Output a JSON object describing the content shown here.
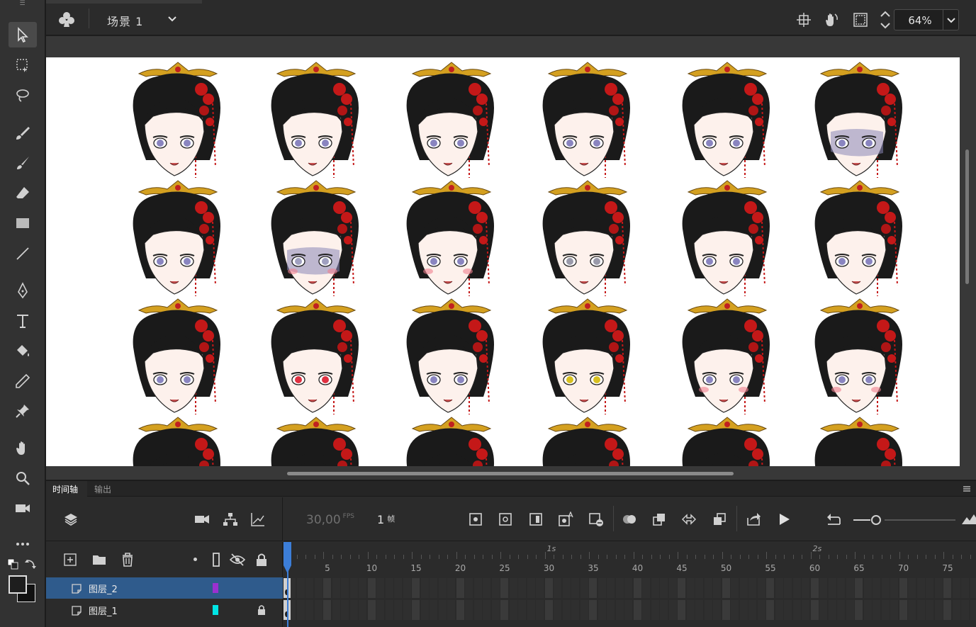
{
  "stage": {
    "scene_name": "场景 1",
    "zoom": "64%"
  },
  "timeline": {
    "tabs": [
      "时间轴",
      "输出"
    ],
    "fps": "30,00",
    "fps_unit": "FPS",
    "current_frame": "1",
    "frame_unit": "帧",
    "ruler_ticks": [
      "5",
      "10",
      "15",
      "20",
      "25",
      "30",
      "35",
      "40",
      "45",
      "50",
      "55",
      "60",
      "65",
      "70",
      "75"
    ],
    "second_labels": [
      "1s",
      "2s"
    ],
    "layers": [
      {
        "name": "图层_2",
        "color": "#9b30d0",
        "locked": false,
        "selected": true
      },
      {
        "name": "图层_1",
        "color": "#00e5e5",
        "locked": true,
        "selected": false
      }
    ]
  },
  "colors": {
    "accent": "#3c7ed8",
    "selected_layer": "#2f5b8c"
  }
}
